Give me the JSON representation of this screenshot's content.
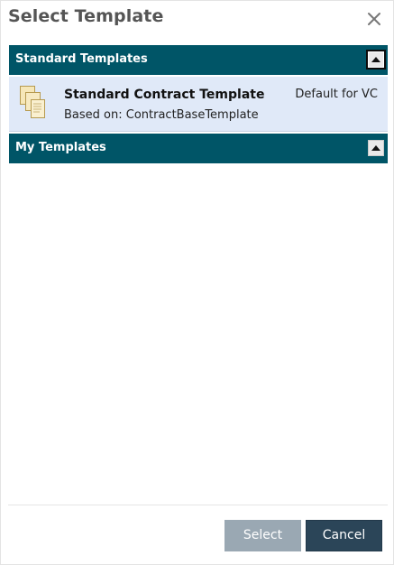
{
  "dialog": {
    "title": "Select Template"
  },
  "sections": {
    "standard": {
      "label": "Standard Templates",
      "expanded": true
    },
    "my": {
      "label": "My Templates",
      "expanded": true
    }
  },
  "templates": [
    {
      "name": "Standard Contract Template",
      "based_on": "Based on: ContractBaseTemplate",
      "badge": "Default for VC"
    }
  ],
  "footer": {
    "select_label": "Select",
    "cancel_label": "Cancel"
  },
  "colors": {
    "section_header_bg": "#005567",
    "selected_row_bg": "#e0e9f8",
    "select_button_disabled": "#9aa8b3",
    "cancel_button": "#2b4558"
  },
  "icons": {
    "close": "close-icon",
    "collapse": "chevron-up-icon",
    "template": "document-stack-icon"
  }
}
